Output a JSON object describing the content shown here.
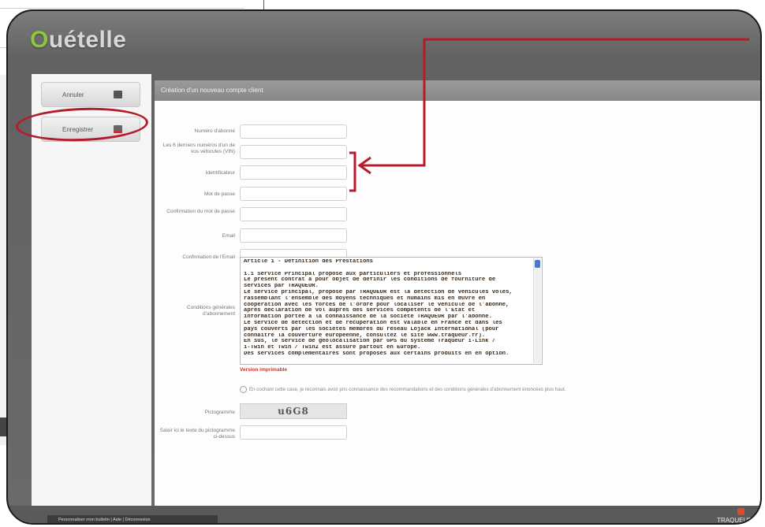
{
  "app": {
    "logo_text": "uételle",
    "logo_initial": "O"
  },
  "sidebar": {
    "cancel_label": "Annuler",
    "save_label": "Enregistrer"
  },
  "main": {
    "header_title": "Création d'un nouveau compte client",
    "fields": {
      "subscriber_number": "Numéro d'abonné",
      "vin_digits": "Les 6 derniers numéros d'un de vos véhicules (VIN)",
      "username": "Identificateur",
      "password": "Mot de passe",
      "password_confirm": "Confirmation du mot de passe",
      "email": "Email",
      "email_confirm": "Confirmation de l'Email",
      "terms": "Conditions générales d'abonnement",
      "captcha": "Pictogramme",
      "captcha_input": "Saisir ici le texte du pictogramme ci-dessus"
    },
    "terms_text": [
      "Article 1 - Définition des Prestations",
      "",
      "1.1 Service Principal proposé aux particuliers et professionnels",
      "Le présent contrat a pour objet de définir les conditions de fourniture de",
      "services par TRAQUEUR.",
      "Le service principal, proposé par TRAQUEUR est la détection de véhicules volés,",
      "rassemblant l'ensemble des moyens techniques et humains mis en œuvre en",
      "coopération avec les forces de l'ordre pour localiser le véhicule de l'abonné,",
      "après déclaration de vol auprès des services compétents de l'État et",
      "information portée à la connaissance de la société TRAQUEUR par l'abonné.",
      "Le service de détection et de récupération est valable en France et dans les",
      "pays couverts par les sociétés membres du réseau Lojack International (pour",
      "connaître la couverture européenne, consultez le site www.traqueur.fr).",
      "En sus, le service de géolocalisation par GPS du système Traqueur i-Link /",
      "i-Twin et Twin / Twin2 est assuré partout en Europe.",
      "Des services complémentaires sont proposés aux certains produits en en option."
    ],
    "printable_label": "Version imprimable",
    "consent_text": "En cochant cette case, je reconnais avoir pris connaissance des recommandations et des conditions générales d'abonnement énoncées plus haut.",
    "captcha_text": "u6G8"
  },
  "footer": {
    "links_text": "Personnaliser mon bulletin  |  Aide  |  Déconnexion",
    "brand": "TRAQUEUR"
  },
  "colors": {
    "annotation": "#b21c2c",
    "logo_accent": "#8cc63f",
    "scroll_thumb": "#4a78c8",
    "printable_link": "#c0392b"
  },
  "icons": {
    "cancel": "undo-arrow-icon",
    "save": "save-disk-icon",
    "footer_brand": "traqueur-logo-icon"
  }
}
